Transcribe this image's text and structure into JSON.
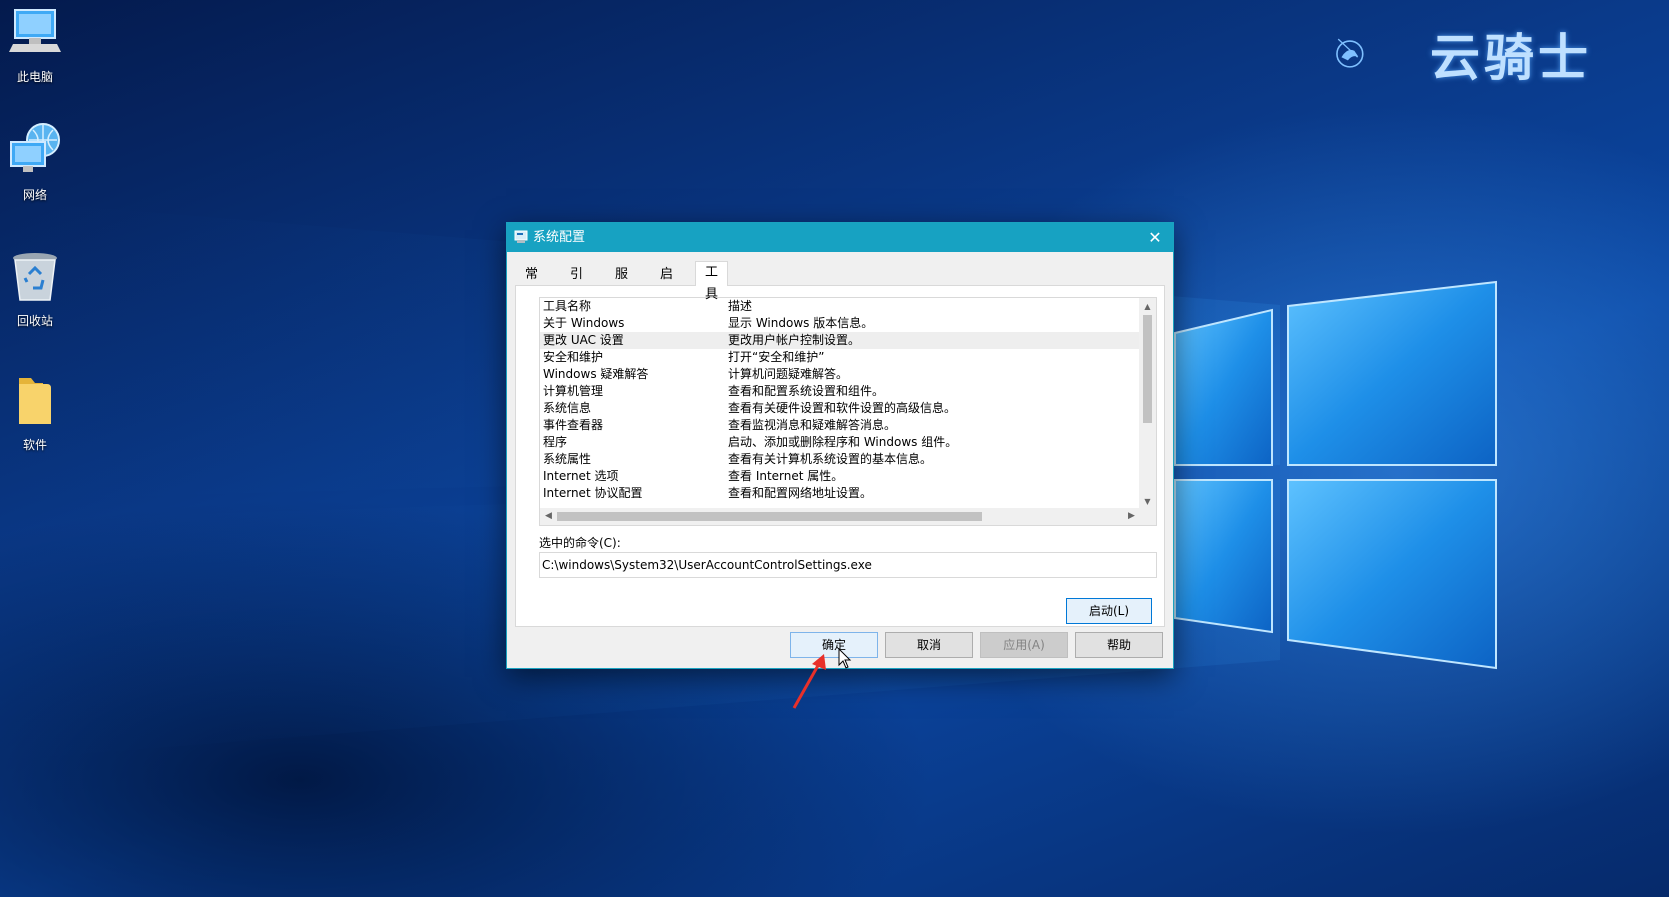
{
  "desktop": {
    "icons": [
      {
        "label": "此电脑"
      },
      {
        "label": "网络"
      },
      {
        "label": "回收站"
      },
      {
        "label": "软件"
      }
    ]
  },
  "watermark": {
    "text": "云骑士"
  },
  "dialog": {
    "title": "系统配置",
    "close_glyph": "✕",
    "tabs": [
      "常规",
      "引导",
      "服务",
      "启动",
      "工具"
    ],
    "active_tab": "工具",
    "list": {
      "headers": {
        "name": "工具名称",
        "desc": "描述"
      },
      "rows": [
        {
          "name": "关于 Windows",
          "desc": "显示 Windows 版本信息。"
        },
        {
          "name": "更改 UAC 设置",
          "desc": "更改用户帐户控制设置。"
        },
        {
          "name": "安全和维护",
          "desc": "打开“安全和维护”"
        },
        {
          "name": "Windows 疑难解答",
          "desc": "计算机问题疑难解答。"
        },
        {
          "name": "计算机管理",
          "desc": "查看和配置系统设置和组件。"
        },
        {
          "name": "系统信息",
          "desc": "查看有关硬件设置和软件设置的高级信息。"
        },
        {
          "name": "事件查看器",
          "desc": "查看监视消息和疑难解答消息。"
        },
        {
          "name": "程序",
          "desc": "启动、添加或删除程序和 Windows 组件。"
        },
        {
          "name": "系统属性",
          "desc": "查看有关计算机系统设置的基本信息。"
        },
        {
          "name": "Internet 选项",
          "desc": "查看 Internet 属性。"
        },
        {
          "name": "Internet 协议配置",
          "desc": "查看和配置网络地址设置。"
        }
      ],
      "selected_row": "更改 UAC 设置"
    },
    "command_label": "选中的命令(C):",
    "command_value": "C:\\windows\\System32\\UserAccountControlSettings.exe",
    "launch_button": "启动(L)",
    "buttons": {
      "ok": "确定",
      "cancel": "取消",
      "apply": "应用(A)",
      "help": "帮助"
    }
  },
  "colors": {
    "titlebar": "#17a2c2",
    "desktop_blue": "#0b47a3",
    "annotation_arrow": "#e8302a"
  }
}
